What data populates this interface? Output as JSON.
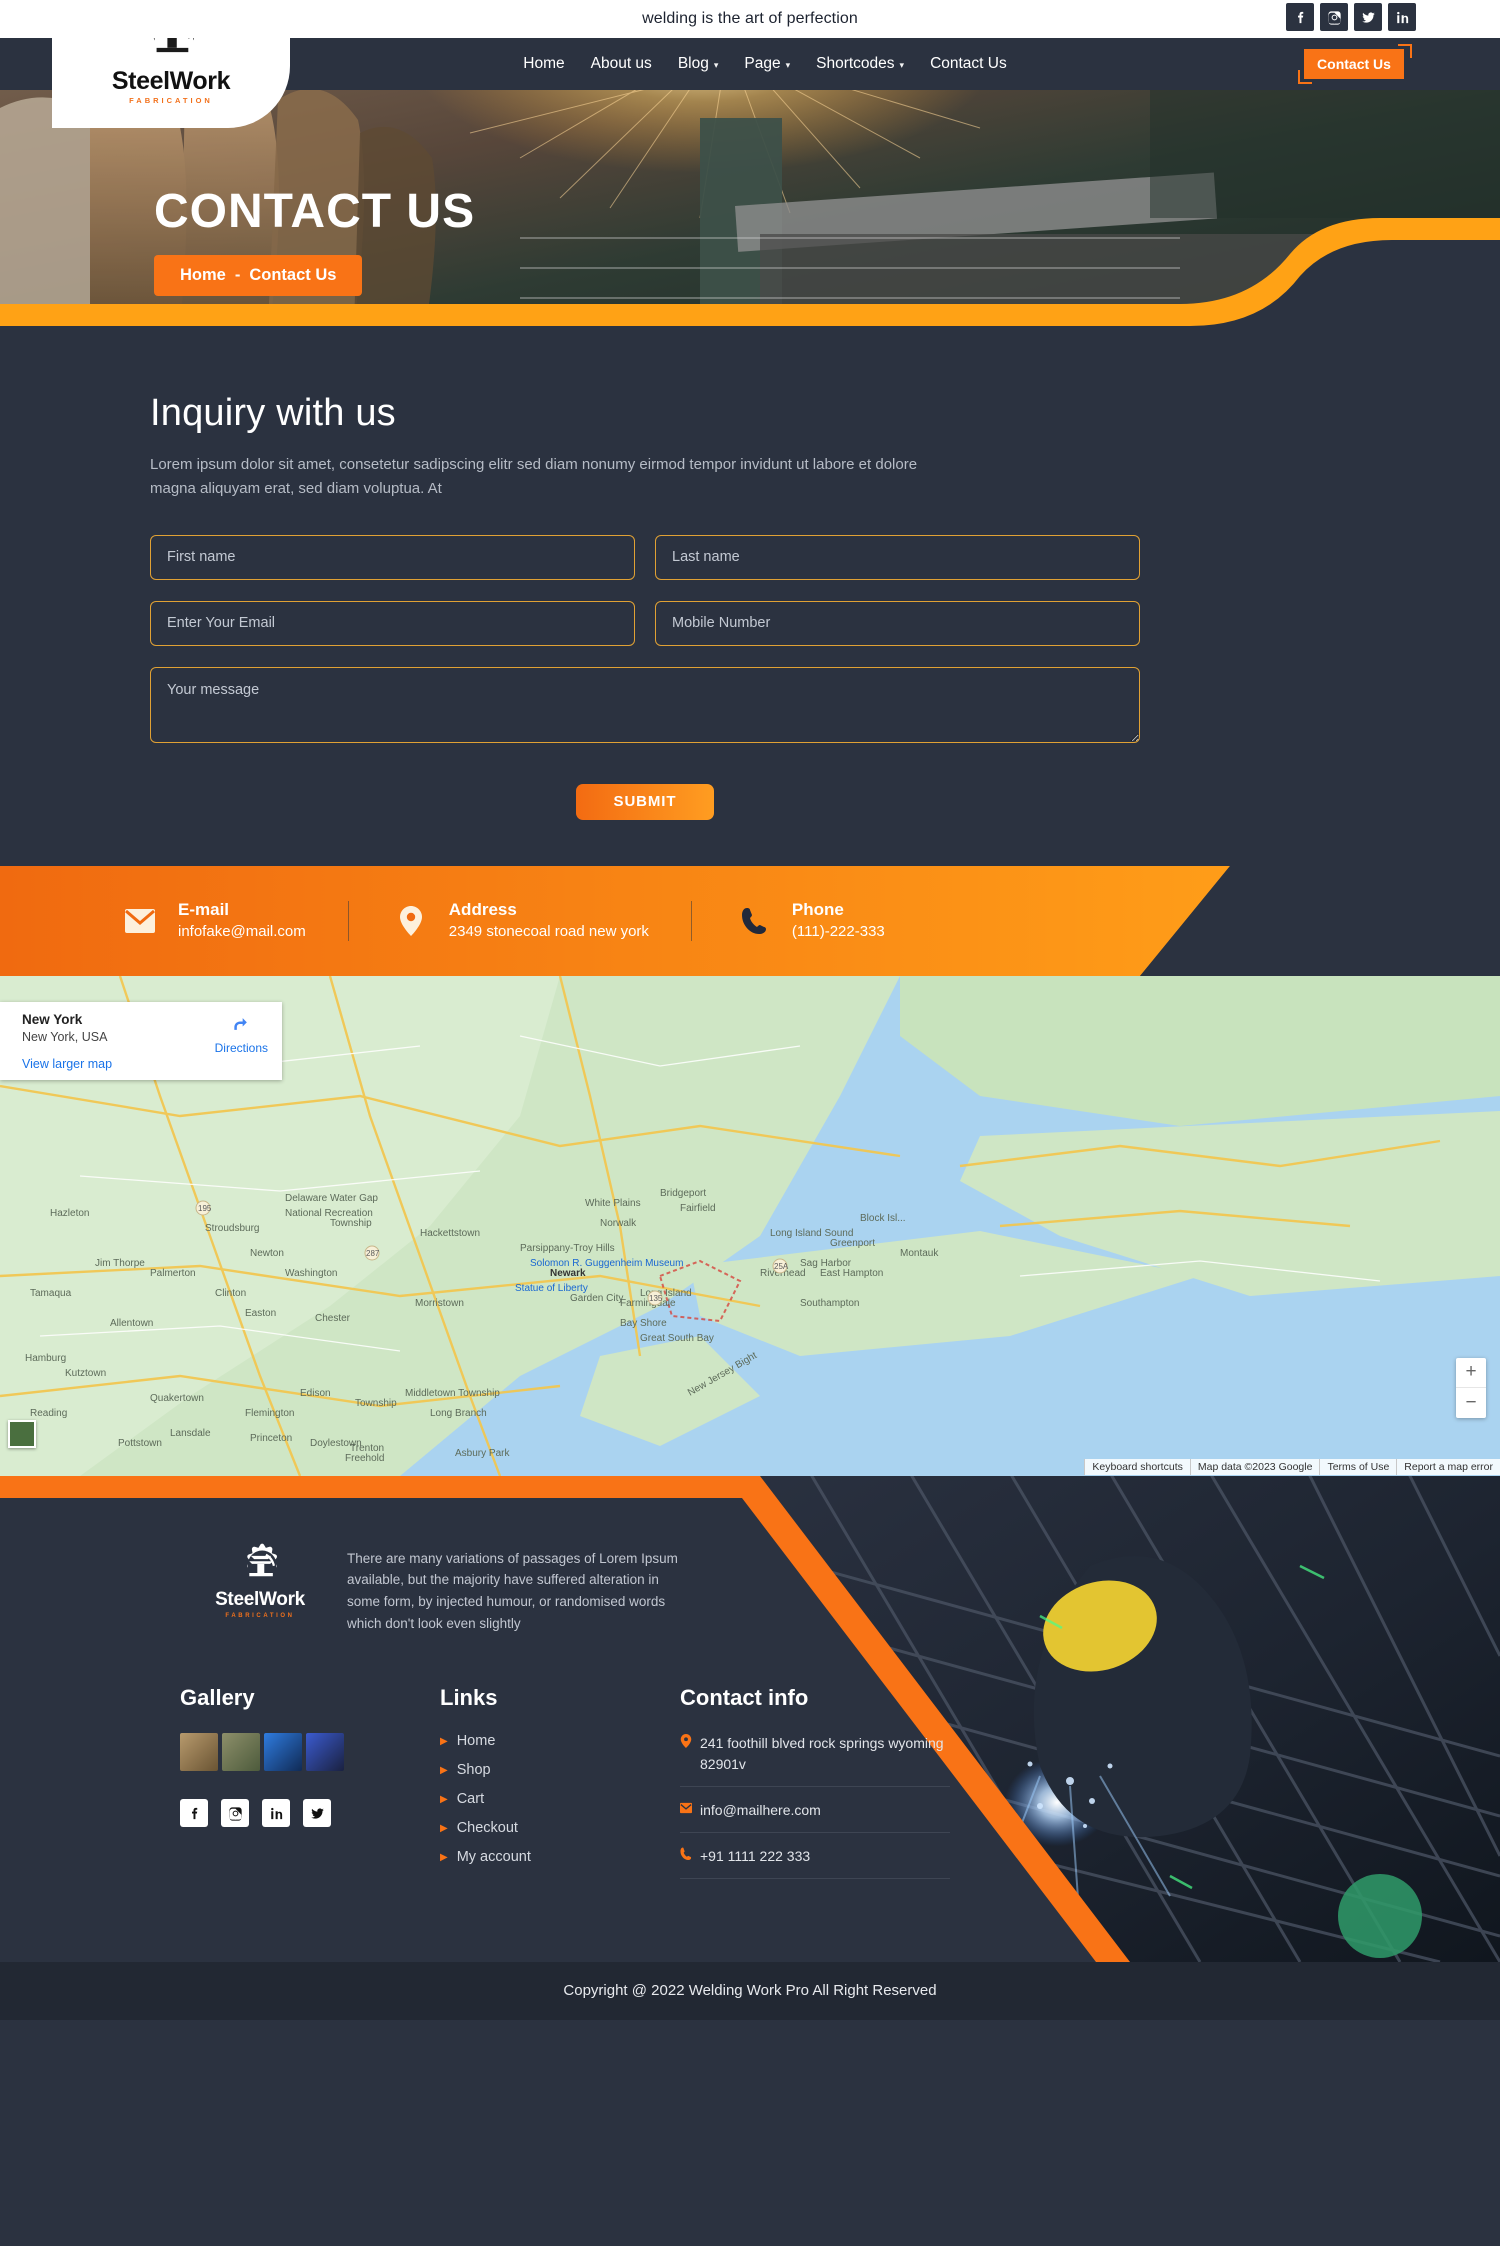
{
  "topbar": {
    "tagline": "welding is the art of perfection",
    "social": [
      {
        "name": "facebook-icon",
        "label": "Facebook"
      },
      {
        "name": "instagram-icon",
        "label": "Instagram"
      },
      {
        "name": "twitter-icon",
        "label": "Twitter"
      },
      {
        "name": "linkedin-icon",
        "label": "LinkedIn"
      }
    ]
  },
  "brand": {
    "name": "SteelWork",
    "tagline": "FABRICATION"
  },
  "nav": {
    "items": [
      {
        "label": "Home",
        "caret": false
      },
      {
        "label": "About us",
        "caret": false
      },
      {
        "label": "Blog",
        "caret": true
      },
      {
        "label": "Page",
        "caret": true
      },
      {
        "label": "Shortcodes",
        "caret": true
      },
      {
        "label": "Contact Us",
        "caret": false
      }
    ],
    "cta_label": "Contact Us"
  },
  "hero": {
    "title": "CONTACT US",
    "crumb_home": "Home",
    "crumb_sep": "-",
    "crumb_current": "Contact Us"
  },
  "inquiry": {
    "title": "Inquiry with us",
    "description": "Lorem ipsum dolor sit amet, consetetur sadipscing elitr sed diam nonumy eirmod tempor invidunt ut labore et dolore magna aliquyam erat, sed diam voluptua. At",
    "first_name_placeholder": "First name",
    "last_name_placeholder": "Last name",
    "email_placeholder": "Enter Your Email",
    "mobile_placeholder": "Mobile Number",
    "message_placeholder": "Your message",
    "submit_label": "SUBMIT"
  },
  "contact_strip": {
    "email_label": "E-mail",
    "email_value": "infofake@mail.com",
    "address_label": "Address",
    "address_value": "2349 stonecoal road new york",
    "phone_label": "Phone",
    "phone_value": "(111)-222-333"
  },
  "map": {
    "card_title": "New York",
    "card_subtitle": "New York, USA",
    "view_larger": "View larger map",
    "directions": "Directions",
    "zoom_in": "+",
    "zoom_out": "−",
    "attribution": [
      "Keyboard shortcuts",
      "Map data ©2023 Google",
      "Terms of Use",
      "Report a map error"
    ]
  },
  "footer": {
    "about": "There are many variations of passages of Lorem Ipsum available, but the majority have suffered alteration in some form, by injected humour, or randomised words which don't look even slightly",
    "gallery_heading": "Gallery",
    "gallery_items": [
      {
        "name": "gallery-thumb-1",
        "color": "#8a7252"
      },
      {
        "name": "gallery-thumb-2",
        "color": "#6a6a55"
      },
      {
        "name": "gallery-thumb-3",
        "color": "#2a5ea8"
      },
      {
        "name": "gallery-thumb-4",
        "color": "#3b4a7e"
      }
    ],
    "social": [
      {
        "name": "facebook-icon",
        "label": "Facebook"
      },
      {
        "name": "instagram-icon",
        "label": "Instagram"
      },
      {
        "name": "linkedin-icon",
        "label": "LinkedIn"
      },
      {
        "name": "twitter-icon",
        "label": "Twitter"
      }
    ],
    "links_heading": "Links",
    "links": [
      {
        "label": "Home"
      },
      {
        "label": "Shop"
      },
      {
        "label": "Cart"
      },
      {
        "label": "Checkout"
      },
      {
        "label": "My account"
      }
    ],
    "contact_heading": "Contact info",
    "contact_address": "241 foothill blved rock springs wyoming 82901v",
    "contact_email": "info@mailhere.com",
    "contact_phone": "+91 1111 222 333"
  },
  "copyright": "Copyright @ 2022 Welding Work Pro All Right Reserved",
  "colors": {
    "accent": "#f97316",
    "accent_bright": "#ffa215",
    "dark": "#2b3240",
    "darker": "#222833",
    "field_border": "#e0a134"
  }
}
